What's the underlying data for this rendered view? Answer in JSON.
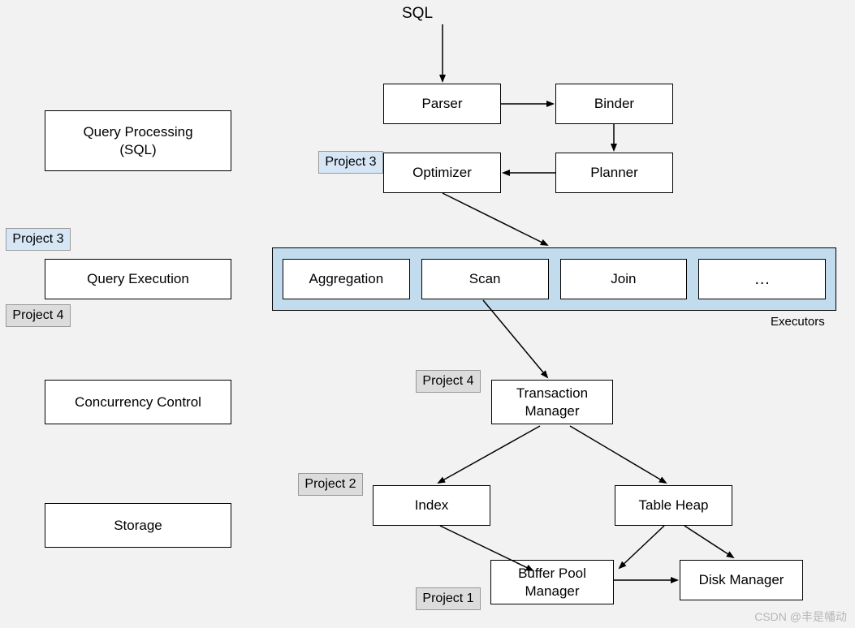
{
  "top_label": "SQL",
  "left": {
    "query_processing": "Query Processing\n(SQL)",
    "query_execution": "Query Execution",
    "concurrency_control": "Concurrency Control",
    "storage": "Storage"
  },
  "nodes": {
    "parser": "Parser",
    "binder": "Binder",
    "optimizer": "Optimizer",
    "planner": "Planner",
    "transaction_manager": "Transaction\nManager",
    "index": "Index",
    "table_heap": "Table Heap",
    "buffer_pool_manager": "Buffer Pool\nManager",
    "disk_manager": "Disk Manager"
  },
  "executors": {
    "aggregation": "Aggregation",
    "scan": "Scan",
    "join": "Join",
    "more": "…",
    "group_label": "Executors"
  },
  "tags": {
    "p3_opt": "Project 3",
    "p3_exec": "Project 3",
    "p4_exec": "Project 4",
    "p4_txn": "Project 4",
    "p2_index": "Project 2",
    "p1_bpm": "Project 1"
  },
  "watermark": "CSDN @丰是幡动"
}
